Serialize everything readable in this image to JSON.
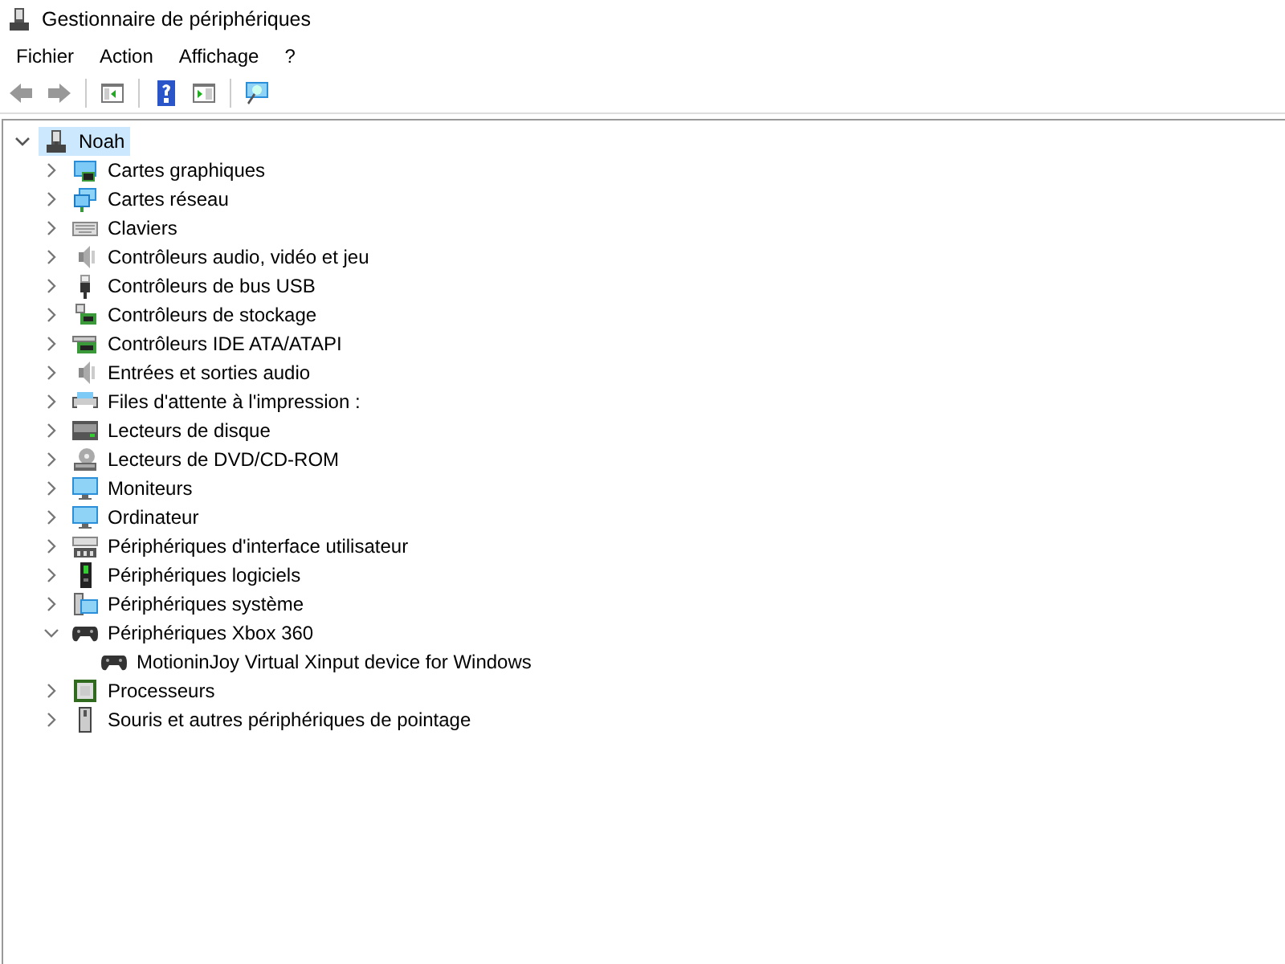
{
  "window": {
    "title": "Gestionnaire de périphériques"
  },
  "menu": [
    "Fichier",
    "Action",
    "Affichage",
    "?"
  ],
  "toolbar": [
    {
      "kind": "back",
      "disabled": true
    },
    {
      "kind": "forward",
      "disabled": true
    },
    {
      "kind": "properties",
      "disabled": false
    },
    {
      "kind": "help",
      "disabled": false
    },
    {
      "kind": "update",
      "disabled": false
    },
    {
      "kind": "scan",
      "disabled": false
    }
  ],
  "tree": {
    "label": "Noah",
    "kind": "computer-root",
    "expanded": true,
    "selected": true,
    "children": [
      {
        "label": "Cartes graphiques",
        "kind": "display",
        "expanded": false
      },
      {
        "label": "Cartes réseau",
        "kind": "network",
        "expanded": false
      },
      {
        "label": "Claviers",
        "kind": "keyboard",
        "expanded": false
      },
      {
        "label": "Contrôleurs audio, vidéo et jeu",
        "kind": "audio",
        "expanded": false
      },
      {
        "label": "Contrôleurs de bus USB",
        "kind": "usb",
        "expanded": false
      },
      {
        "label": "Contrôleurs de stockage",
        "kind": "storage",
        "expanded": false
      },
      {
        "label": "Contrôleurs IDE ATA/ATAPI",
        "kind": "ide",
        "expanded": false
      },
      {
        "label": "Entrées et sorties audio",
        "kind": "audio",
        "expanded": false
      },
      {
        "label": "Files d'attente à l'impression :",
        "kind": "printer",
        "expanded": false
      },
      {
        "label": "Lecteurs de disque",
        "kind": "disk",
        "expanded": false
      },
      {
        "label": "Lecteurs de DVD/CD-ROM",
        "kind": "dvd",
        "expanded": false
      },
      {
        "label": "Moniteurs",
        "kind": "monitor",
        "expanded": false
      },
      {
        "label": "Ordinateur",
        "kind": "monitor",
        "expanded": false
      },
      {
        "label": "Périphériques d'interface utilisateur",
        "kind": "hid",
        "expanded": false
      },
      {
        "label": "Périphériques logiciels",
        "kind": "software",
        "expanded": false
      },
      {
        "label": "Périphériques système",
        "kind": "system",
        "expanded": false
      },
      {
        "label": "Périphériques Xbox 360",
        "kind": "gamepad",
        "expanded": true,
        "children": [
          {
            "label": "MotioninJoy Virtual Xinput device for Windows",
            "kind": "gamepad"
          }
        ]
      },
      {
        "label": "Processeurs",
        "kind": "cpu",
        "expanded": false
      },
      {
        "label": "Souris et autres périphériques de pointage",
        "kind": "mouse",
        "expanded": false
      }
    ]
  }
}
